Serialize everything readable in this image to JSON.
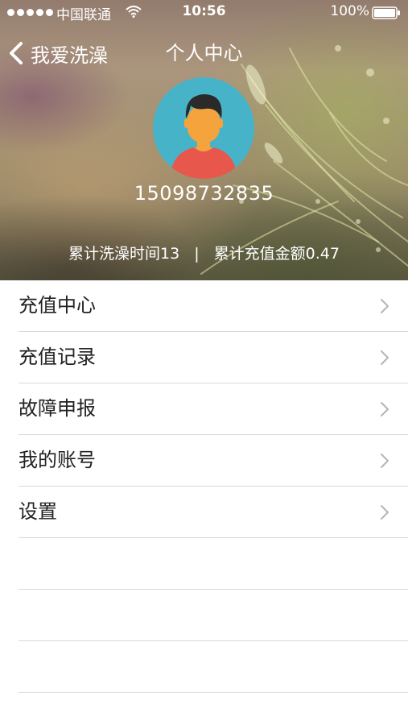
{
  "status_bar": {
    "carrier": "中国联通",
    "time": "10:56",
    "battery": "100%",
    "signal_icon": "signal-dots-icon",
    "wifi_icon": "wifi-icon",
    "battery_icon": "battery-icon"
  },
  "nav": {
    "back_label": "我爱洗澡",
    "title": "个人中心",
    "back_icon": "chevron-left-icon"
  },
  "profile": {
    "avatar_icon": "user-avatar-icon",
    "phone": "15098732835",
    "stat_bath_time": "累计洗澡时间13",
    "stat_separator": "|",
    "stat_recharge": "累计充值金额0.47"
  },
  "menu": {
    "items": [
      {
        "label": "充值中心",
        "icon": "chevron-right-icon"
      },
      {
        "label": "充值记录",
        "icon": "chevron-right-icon"
      },
      {
        "label": "故障申报",
        "icon": "chevron-right-icon"
      },
      {
        "label": "我的账号",
        "icon": "chevron-right-icon"
      },
      {
        "label": "设置",
        "icon": "chevron-right-icon"
      }
    ]
  },
  "colors": {
    "avatar_bg": "#47b3c8",
    "avatar_shirt": "#e8574b",
    "avatar_face": "#f4a33d",
    "avatar_hair": "#2a2a2a",
    "divider": "#d9d9d9",
    "chevron": "#b5b5b5",
    "text": "#222222"
  }
}
